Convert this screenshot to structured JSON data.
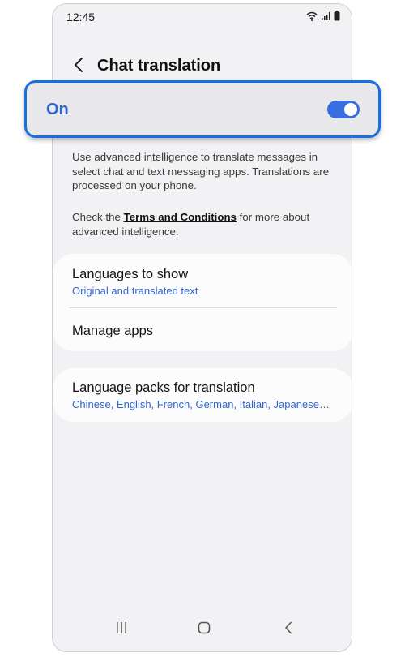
{
  "status_bar": {
    "time": "12:45",
    "icons": [
      "wifi-icon",
      "signal-icon",
      "battery-icon"
    ]
  },
  "header": {
    "title": "Chat translation",
    "back_icon": "chevron-left-icon"
  },
  "master_switch": {
    "label": "On",
    "state": "on",
    "accent_color": "#3a6ee0",
    "highlight_color": "#1a6fe0"
  },
  "description": {
    "paragraph_1": "Use advanced intelligence to translate messages in select chat and text messaging apps. Translations are processed on your phone.",
    "paragraph_2_prefix": "Check the ",
    "paragraph_2_link": "Terms and Conditions",
    "paragraph_2_suffix": " for more about advanced intelligence."
  },
  "settings": {
    "languages_to_show": {
      "title": "Languages to show",
      "value": "Original and translated text"
    },
    "manage_apps": {
      "title": "Manage apps"
    },
    "language_packs": {
      "title": "Language packs for translation",
      "value": "Chinese, English, French, German, Italian, Japanese, K..."
    }
  },
  "nav_bar": {
    "icons": [
      "recent-apps-icon",
      "home-icon",
      "back-icon"
    ]
  }
}
